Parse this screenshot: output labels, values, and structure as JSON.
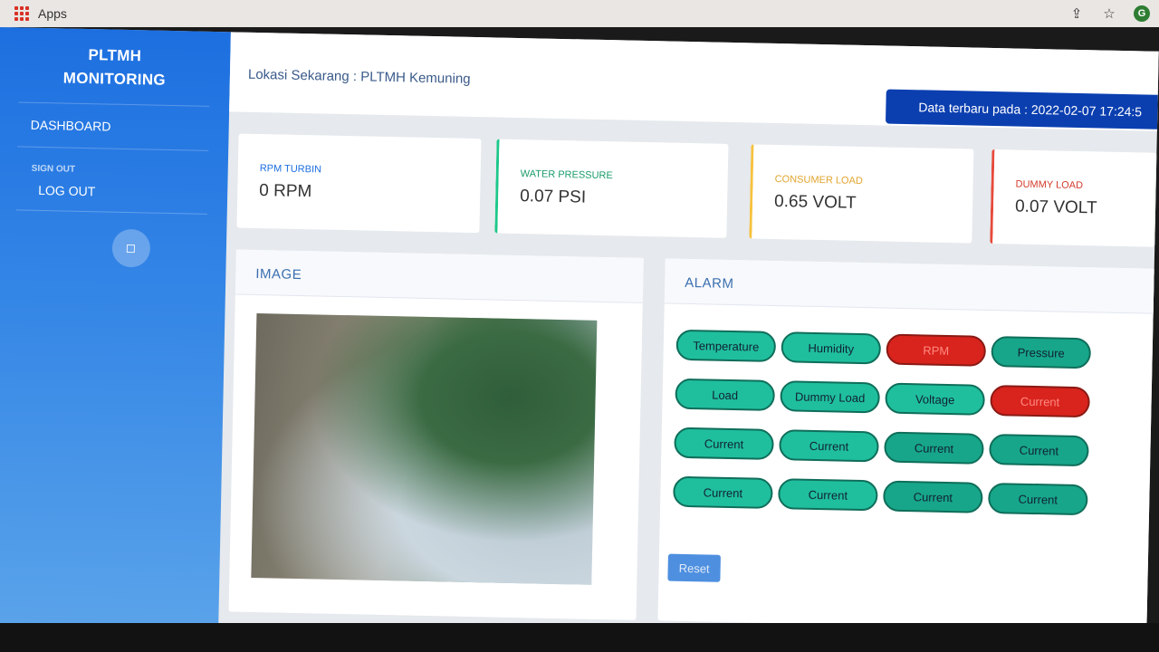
{
  "browser": {
    "apps_label": "Apps"
  },
  "sidebar": {
    "brand_line1": "PLTMH",
    "brand_line2": "MONITORING",
    "dashboard": "DASHBOARD",
    "section_signout": "SIGN OUT",
    "logout": "LOG OUT"
  },
  "topbar": {
    "location": "Lokasi Sekarang : PLTMH Kemuning",
    "latest_data": "Data terbaru pada : 2022-02-07 17:24:5"
  },
  "cards": [
    {
      "label": "RPM TURBIN",
      "value": "0 RPM"
    },
    {
      "label": "WATER PRESSURE",
      "value": "0.07 PSI"
    },
    {
      "label": "CONSUMER LOAD",
      "value": "0.65 VOLT"
    },
    {
      "label": "DUMMY LOAD",
      "value": "0.07 VOLT"
    }
  ],
  "image_panel": {
    "title": "IMAGE"
  },
  "alarm_panel": {
    "title": "ALARM",
    "pills": [
      {
        "label": "Temperature",
        "state": "ok"
      },
      {
        "label": "Humidity",
        "state": "ok"
      },
      {
        "label": "RPM",
        "state": "alert"
      },
      {
        "label": "Pressure",
        "state": "ok"
      },
      {
        "label": "Load",
        "state": "ok"
      },
      {
        "label": "Dummy Load",
        "state": "ok"
      },
      {
        "label": "Voltage",
        "state": "ok"
      },
      {
        "label": "Current",
        "state": "alert"
      },
      {
        "label": "Current",
        "state": "ok"
      },
      {
        "label": "Current",
        "state": "ok"
      },
      {
        "label": "Current",
        "state": "ok"
      },
      {
        "label": "Current",
        "state": "ok"
      },
      {
        "label": "Current",
        "state": "ok"
      },
      {
        "label": "Current",
        "state": "ok"
      },
      {
        "label": "Current",
        "state": "ok"
      },
      {
        "label": "Current",
        "state": "ok"
      }
    ],
    "reset_label": "Reset"
  },
  "colors": {
    "sidebar_top": "#1d6fe0",
    "ok_pill": "#1fbf9e",
    "alert_pill": "#d9231d",
    "latest_banner": "#0b3fb0"
  }
}
